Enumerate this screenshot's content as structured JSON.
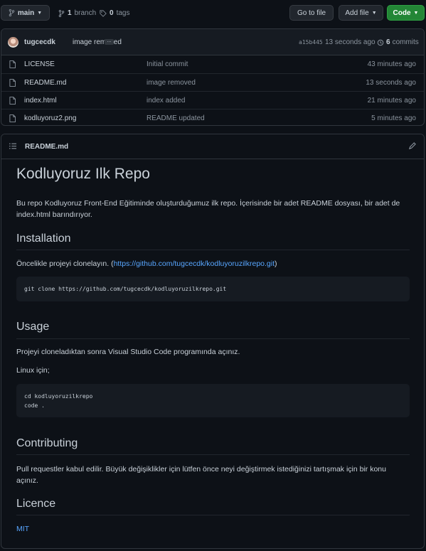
{
  "toolbar": {
    "branch": "main",
    "branches_count": "1",
    "branches_label": "branch",
    "tags_count": "0",
    "tags_label": "tags",
    "go_to_file": "Go to file",
    "add_file": "Add file",
    "code": "Code"
  },
  "commit": {
    "author": "tugcecdk",
    "message": "image removed",
    "ellipsis": "...",
    "sha": "a15b445",
    "time": "13 seconds ago",
    "count": "6",
    "count_label": "commits"
  },
  "files": [
    {
      "name": "LICENSE",
      "message": "Initial commit",
      "age": "43 minutes ago"
    },
    {
      "name": "README.md",
      "message": "image removed",
      "age": "13 seconds ago"
    },
    {
      "name": "index.html",
      "message": "index added",
      "age": "21 minutes ago"
    },
    {
      "name": "kodluyoruz2.png",
      "message": "README updated",
      "age": "5 minutes ago"
    }
  ],
  "readme": {
    "filename": "README.md",
    "h1": "Kodluyoruz Ilk Repo",
    "intro": "Bu repo Kodluyoruz Front-End Eğitiminde oluşturduğumuz ilk repo. İçerisinde bir adet README dosyası, bir adet de index.html barındırıyor.",
    "installation_heading": "Installation",
    "installation_text_before": "Öncelikle projeyi clonelayın. (",
    "installation_link": "https://github.com/tugcecdk/kodluyoruzilkrepo.git",
    "installation_text_after": ")",
    "install_code": "git clone https://github.com/tugcecdk/kodluyoruzilkrepo.git",
    "usage_heading": "Usage",
    "usage_text": "Projeyi cloneladıktan sonra Visual Studio Code programında açınız.",
    "linux_text": "Linux için;",
    "usage_code_1": "cd kodluyoruzilkrepo",
    "usage_code_2": "code .",
    "contributing_heading": "Contributing",
    "contributing_text": "Pull requestler kabul edilir. Büyük değişiklikler için lütfen önce neyi değiştirmek istediğinizi tartışmak için bir konu açınız.",
    "licence_heading": "Licence",
    "licence_link": "MIT"
  },
  "colors": {
    "background": "#0d1117",
    "link": "#58a6ff",
    "green_button": "#238636"
  }
}
